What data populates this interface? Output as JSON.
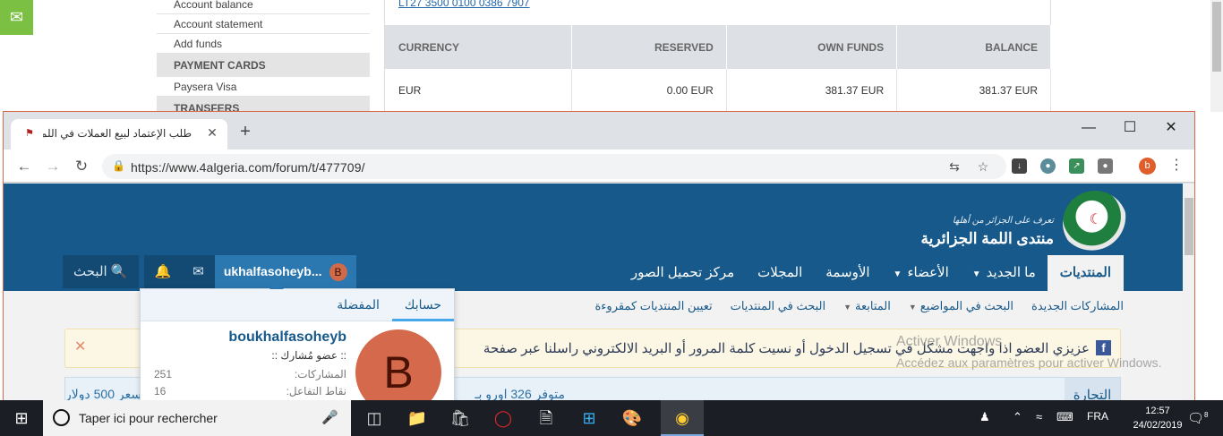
{
  "background_page": {
    "chat_icon": "chat-bubble-icon",
    "sidebar": {
      "links_top": [
        "Account balance",
        "Account statement",
        "Add funds"
      ],
      "section1": "PAYMENT CARDS",
      "link_card": "Paysera Visa",
      "section2": "TRANSFERS"
    },
    "iban": "LT27 3500 0100 0386 7907",
    "table": {
      "headers": [
        "CURRENCY",
        "RESERVED",
        "OWN FUNDS",
        "BALANCE"
      ],
      "row": [
        "EUR",
        "0.00 EUR",
        "381.37 EUR",
        "381.37 EUR"
      ]
    }
  },
  "browser": {
    "tab_title": "طلب الإعتماد لبيع العملات في اللمة",
    "new_tab": "+",
    "url": "https://www.4algeria.com/forum/t/477709/",
    "profile_letter": "b",
    "window_controls": {
      "minimize": "—",
      "maximize": "☐",
      "close": "✕"
    }
  },
  "forum": {
    "logo_title": "منتدى اللمة الجزائرية",
    "logo_subtitle": "تعرف على الجزائر من أهلها",
    "nav": [
      "المنتديات",
      "ما الجديد",
      "الأعضاء",
      "الأوسمة",
      "المجلات",
      "مركز تحميل الصور"
    ],
    "nav_carets": [
      false,
      true,
      true,
      false,
      false,
      false
    ],
    "user": {
      "name": "ukhalfasoheyb...",
      "avatar": "B",
      "search": "البحث"
    },
    "subnav": [
      "المشاركات الجديدة",
      "البحث في المواضيع",
      "المتابعة",
      "البحث في المنتديات",
      "تعيين المنتديات كمقروءة"
    ],
    "notice": "عزيزي العضو اذا واجهت مشكل في تسجيل الدخول أو نسيت كلمة المرور أو البريد الالكتروني راسلنا عبر صفحة",
    "row2_label": "التجارة",
    "row2_text": "متوفر 326 اورو بـ",
    "row2_left": "سعر 500 دولار",
    "popup": {
      "tab_account": "حسابك",
      "tab_favorites": "المفضلة",
      "username": "boukhalfasoheyb",
      "title": ":: عضو مُشارك ::",
      "stats": [
        {
          "label": "المشاركات:",
          "value": "251"
        },
        {
          "label": "نقاط التفاعل:",
          "value": "16"
        }
      ],
      "avatar_letter": "B"
    },
    "watermark_line1": "Activer Windows",
    "watermark_line2": "Accédez aux paramètres pour activer Windows."
  },
  "taskbar": {
    "search_placeholder": "Taper ici pour rechercher",
    "language": "FRA",
    "time": "12:57",
    "date": "24/02/2019",
    "notification_count": "8"
  }
}
